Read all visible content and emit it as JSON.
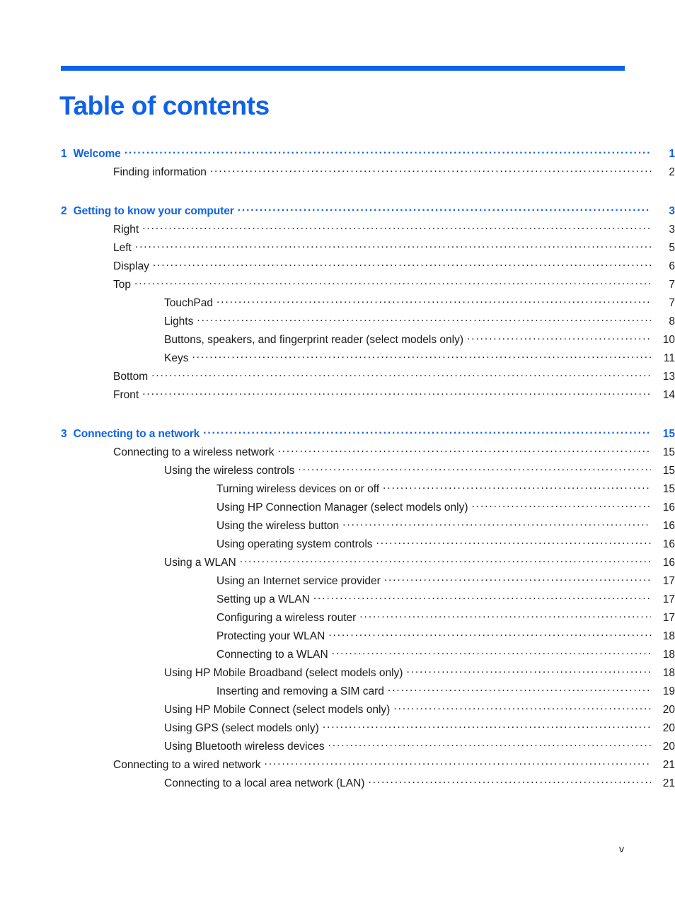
{
  "document": {
    "title": "Table of contents",
    "folio": "v",
    "accent_color": "#0f62e8",
    "text_color": "#1a1a1a"
  },
  "toc": {
    "entries": [
      {
        "level": 0,
        "number": "1",
        "label": "Welcome",
        "page": "1",
        "chapter": true,
        "gap_before": false
      },
      {
        "level": 1,
        "number": "",
        "label": "Finding information",
        "page": "2",
        "chapter": false,
        "gap_before": false
      },
      {
        "level": 0,
        "number": "2",
        "label": "Getting to know your computer",
        "page": "3",
        "chapter": true,
        "gap_before": true
      },
      {
        "level": 1,
        "number": "",
        "label": "Right",
        "page": "3",
        "chapter": false,
        "gap_before": false
      },
      {
        "level": 1,
        "number": "",
        "label": "Left",
        "page": "5",
        "chapter": false,
        "gap_before": false
      },
      {
        "level": 1,
        "number": "",
        "label": "Display",
        "page": "6",
        "chapter": false,
        "gap_before": false
      },
      {
        "level": 1,
        "number": "",
        "label": "Top",
        "page": "7",
        "chapter": false,
        "gap_before": false
      },
      {
        "level": 2,
        "number": "",
        "label": "TouchPad",
        "page": "7",
        "chapter": false,
        "gap_before": false
      },
      {
        "level": 2,
        "number": "",
        "label": "Lights",
        "page": "8",
        "chapter": false,
        "gap_before": false
      },
      {
        "level": 2,
        "number": "",
        "label": "Buttons, speakers, and fingerprint reader (select models only)",
        "page": "10",
        "chapter": false,
        "gap_before": false
      },
      {
        "level": 2,
        "number": "",
        "label": "Keys",
        "page": "11",
        "chapter": false,
        "gap_before": false
      },
      {
        "level": 1,
        "number": "",
        "label": "Bottom",
        "page": "13",
        "chapter": false,
        "gap_before": false
      },
      {
        "level": 1,
        "number": "",
        "label": "Front",
        "page": "14",
        "chapter": false,
        "gap_before": false
      },
      {
        "level": 0,
        "number": "3",
        "label": "Connecting to a network",
        "page": "15",
        "chapter": true,
        "gap_before": true
      },
      {
        "level": 1,
        "number": "",
        "label": "Connecting to a wireless network",
        "page": "15",
        "chapter": false,
        "gap_before": false
      },
      {
        "level": 2,
        "number": "",
        "label": "Using the wireless controls",
        "page": "15",
        "chapter": false,
        "gap_before": false
      },
      {
        "level": 3,
        "number": "",
        "label": "Turning wireless devices on or off",
        "page": "15",
        "chapter": false,
        "gap_before": false
      },
      {
        "level": 3,
        "number": "",
        "label": "Using HP Connection Manager (select models only)",
        "page": "16",
        "chapter": false,
        "gap_before": false
      },
      {
        "level": 3,
        "number": "",
        "label": "Using the wireless button",
        "page": "16",
        "chapter": false,
        "gap_before": false
      },
      {
        "level": 3,
        "number": "",
        "label": "Using operating system controls",
        "page": "16",
        "chapter": false,
        "gap_before": false
      },
      {
        "level": 2,
        "number": "",
        "label": "Using a WLAN",
        "page": "16",
        "chapter": false,
        "gap_before": false
      },
      {
        "level": 3,
        "number": "",
        "label": "Using an Internet service provider",
        "page": "17",
        "chapter": false,
        "gap_before": false
      },
      {
        "level": 3,
        "number": "",
        "label": "Setting up a WLAN",
        "page": "17",
        "chapter": false,
        "gap_before": false
      },
      {
        "level": 3,
        "number": "",
        "label": "Configuring a wireless router",
        "page": "17",
        "chapter": false,
        "gap_before": false
      },
      {
        "level": 3,
        "number": "",
        "label": "Protecting your WLAN",
        "page": "18",
        "chapter": false,
        "gap_before": false
      },
      {
        "level": 3,
        "number": "",
        "label": "Connecting to a WLAN",
        "page": "18",
        "chapter": false,
        "gap_before": false
      },
      {
        "level": 2,
        "number": "",
        "label": "Using HP Mobile Broadband (select models only)",
        "page": "18",
        "chapter": false,
        "gap_before": false
      },
      {
        "level": 3,
        "number": "",
        "label": "Inserting and removing a SIM card",
        "page": "19",
        "chapter": false,
        "gap_before": false
      },
      {
        "level": 2,
        "number": "",
        "label": "Using HP Mobile Connect (select models only)",
        "page": "20",
        "chapter": false,
        "gap_before": false
      },
      {
        "level": 2,
        "number": "",
        "label": "Using GPS (select models only)",
        "page": "20",
        "chapter": false,
        "gap_before": false
      },
      {
        "level": 2,
        "number": "",
        "label": "Using Bluetooth wireless devices",
        "page": "20",
        "chapter": false,
        "gap_before": false
      },
      {
        "level": 1,
        "number": "",
        "label": "Connecting to a wired network",
        "page": "21",
        "chapter": false,
        "gap_before": false
      },
      {
        "level": 2,
        "number": "",
        "label": "Connecting to a local area network (LAN)",
        "page": "21",
        "chapter": false,
        "gap_before": false
      }
    ]
  }
}
